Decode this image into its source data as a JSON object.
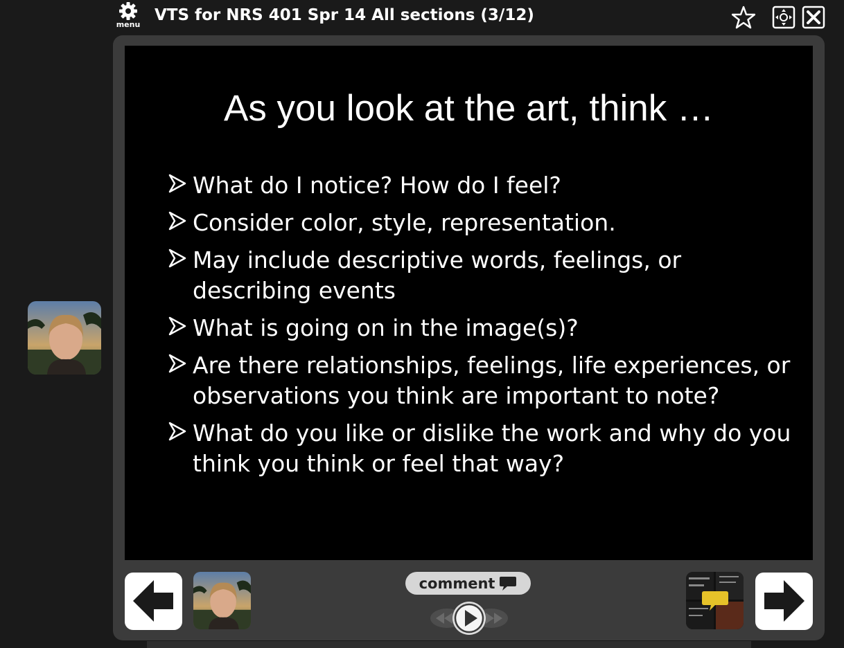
{
  "topbar": {
    "menu_label": "menu",
    "title": "VTS for NRS 401 Spr 14 All sections (3/12)",
    "icons": [
      "gear-icon",
      "star-icon",
      "expand-icon",
      "close-icon"
    ]
  },
  "slide": {
    "title": "As you look at the art, think …",
    "bullets": [
      "What do I notice? How do I feel?",
      "Consider color, style, representation.",
      "May include descriptive words, feelings, or describing events",
      "What is going on in the image(s)?",
      "Are there relationships, feelings, life experiences, or observations you think are important to note?",
      "What do you like or dislike the work and why do you think you think or feel that way?"
    ]
  },
  "controls": {
    "comment_label": "comment",
    "prev_icon": "arrow-left-icon",
    "next_icon": "arrow-right-icon",
    "play_icon": "play-icon"
  },
  "colors": {
    "background": "#1a1a1a",
    "frame": "#3b3b3b",
    "slide_bg": "#000000",
    "comment_bg": "#d6d6d6",
    "accent_yellow": "#e6c229"
  }
}
